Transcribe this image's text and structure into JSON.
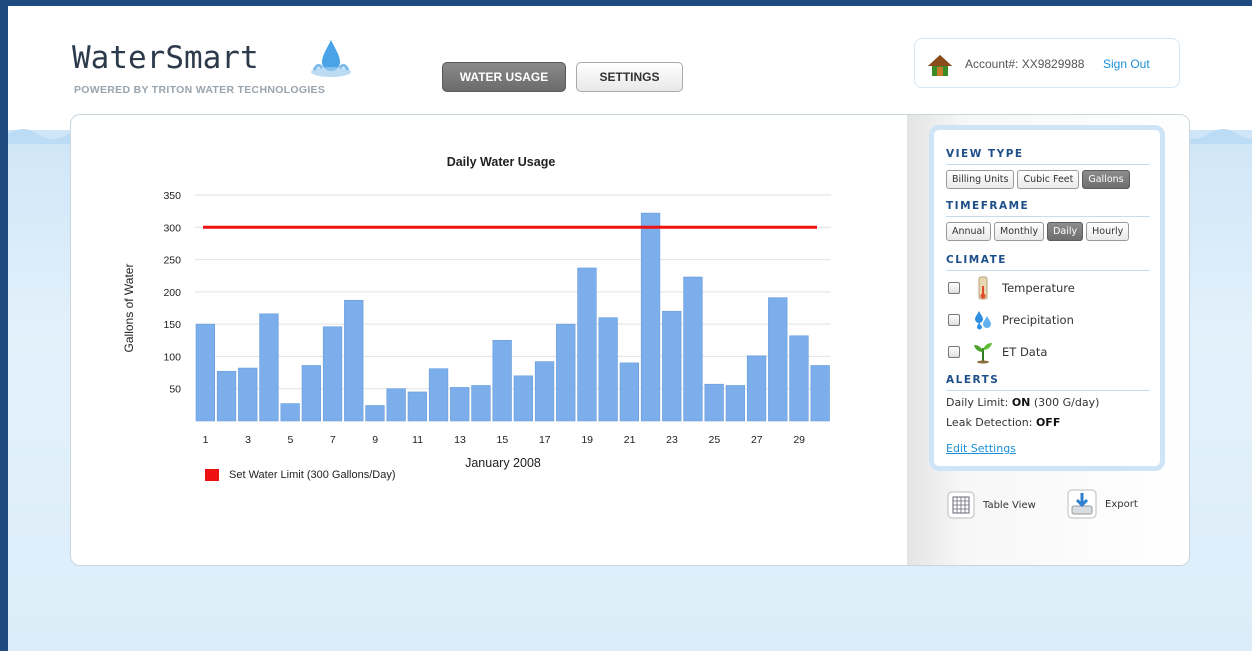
{
  "header": {
    "logo_title": "WaterSmart",
    "logo_subtitle": "POWERED BY TRITON WATER TECHNOLOGIES",
    "nav": {
      "water_usage": "WATER USAGE",
      "settings": "SETTINGS",
      "active": "WATER USAGE"
    },
    "account": {
      "label": "Account#: XX9829988",
      "sign_out": "Sign Out"
    }
  },
  "sidebar": {
    "view_type": {
      "title": "VIEW TYPE",
      "options": [
        "Billing Units",
        "Cubic Feet",
        "Gallons"
      ],
      "selected": "Gallons"
    },
    "timeframe": {
      "title": "TIMEFRAME",
      "options": [
        "Annual",
        "Monthly",
        "Daily",
        "Hourly"
      ],
      "selected": "Daily"
    },
    "climate": {
      "title": "CLIMATE",
      "items": [
        {
          "label": "Temperature",
          "icon": "thermometer-icon",
          "checked": false
        },
        {
          "label": "Precipitation",
          "icon": "water-drops-icon",
          "checked": false
        },
        {
          "label": "ET Data",
          "icon": "plant-icon",
          "checked": false
        }
      ]
    },
    "alerts": {
      "title": "ALERTS",
      "daily_limit_label": "Daily Limit:",
      "daily_limit_state": "ON",
      "daily_limit_detail": "(300 G/day)",
      "leak_label": "Leak Detection:",
      "leak_state": "OFF",
      "edit_link": "Edit Settings"
    },
    "tools": {
      "table_view": "Table View",
      "export": "Export"
    }
  },
  "colors": {
    "bar": "#7baeea",
    "limit_line": "#ee1111",
    "accent": "#1a8fd8",
    "brand_dark": "#1d4f8a"
  },
  "chart_data": {
    "type": "bar",
    "title": "Daily Water Usage",
    "xlabel": "January 2008",
    "ylabel": "Gallons of Water",
    "ylim": [
      0,
      350
    ],
    "yticks": [
      50,
      100,
      150,
      200,
      250,
      300,
      350
    ],
    "x_tick_labels": [
      "1",
      "3",
      "5",
      "7",
      "9",
      "11",
      "13",
      "15",
      "17",
      "19",
      "21",
      "23",
      "25",
      "27",
      "29"
    ],
    "categories": [
      "1",
      "2",
      "3",
      "4",
      "5",
      "6",
      "7",
      "8",
      "9",
      "10",
      "11",
      "12",
      "13",
      "14",
      "15",
      "16",
      "17",
      "18",
      "19",
      "20",
      "21",
      "22",
      "23",
      "24",
      "25",
      "26",
      "27",
      "28",
      "29",
      "30"
    ],
    "values": [
      150,
      77,
      82,
      166,
      27,
      86,
      146,
      187,
      24,
      50,
      45,
      81,
      52,
      55,
      125,
      70,
      92,
      150,
      237,
      160,
      90,
      322,
      170,
      223,
      57,
      55,
      101,
      191,
      132,
      86
    ],
    "limit": {
      "value": 300,
      "label": "Set Water Limit (300 Gallons/Day)"
    },
    "grid": true,
    "legend_position": "bottom-left"
  }
}
